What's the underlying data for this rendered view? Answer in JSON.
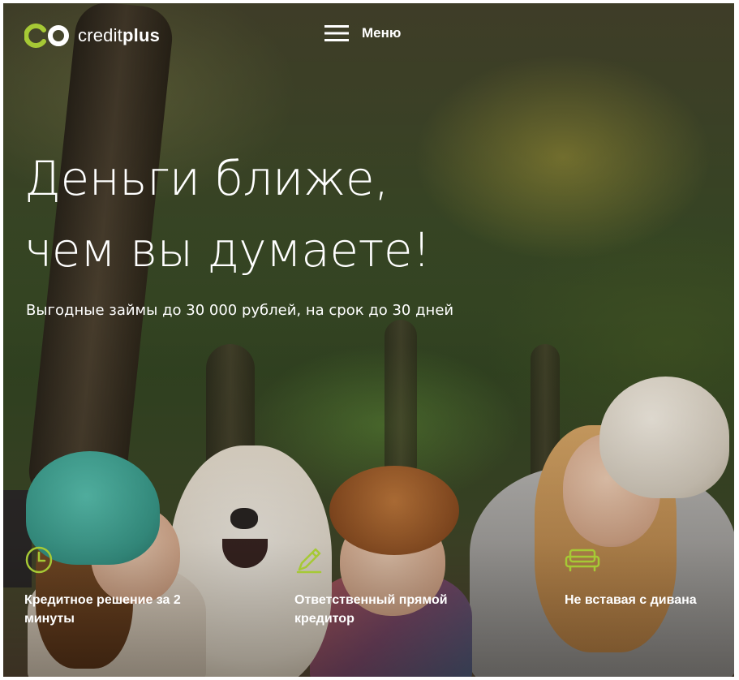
{
  "header": {
    "logo": {
      "word1": "credit",
      "word2": "plus"
    },
    "menu_label": "Меню"
  },
  "hero": {
    "headline_line1": "Деньги ближе,",
    "headline_line2": "чем вы думаете!",
    "subline": "Выгодные займы до 30 000 рублей, на срок до 30 дней"
  },
  "features": [
    {
      "icon": "clock-icon",
      "text": "Кредитное решение за 2 минуты"
    },
    {
      "icon": "pencil-icon",
      "text": "Ответственный прямой кредитор"
    },
    {
      "icon": "sofa-icon",
      "text": "Не вставая с дивана"
    }
  ],
  "colors": {
    "accent": "#a6c935",
    "text_light": "#ffffff"
  }
}
